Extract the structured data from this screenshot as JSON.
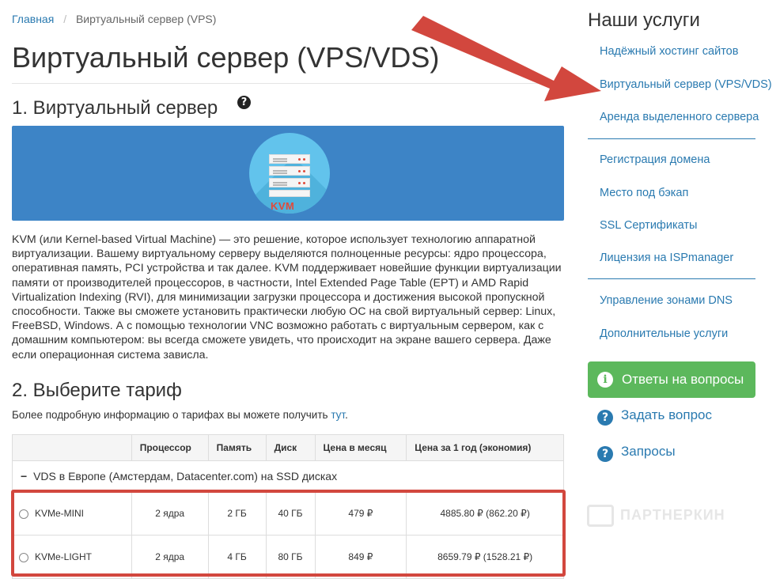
{
  "breadcrumb": {
    "home": "Главная",
    "current": "Виртуальный сервер (VPS)"
  },
  "page_title": "Виртуальный сервер (VPS/VDS)",
  "section1": {
    "title": "1. Виртуальный сервер",
    "help_glyph": "?"
  },
  "banner": {
    "label": "KVM",
    "icon": "server-icon",
    "color": "#3d84c6"
  },
  "description": "KVM (или Kernel-based Virtual Machine) — это решение, которое использует технологию аппаратной виртуализации. Вашему виртуальному серверу выделяются полноценные ресурсы: ядро процессора, оперативная память, PCI устройства и так далее. KVM поддерживает новейшие функции виртуализации памяти от производителей процессоров, в частности, Intel Extended Page Table (EPT) и AMD Rapid Virtualization Indexing (RVI), для минимизации загрузки процессора и достижения высокой пропускной способности. Также вы сможете установить практически любую ОС на свой виртуальный сервер: Linux, FreeBSD, Windows. А с помощью технологии VNC возможно работать с виртуальным сервером, как с домашним компьютером: вы всегда сможете увидеть, что происходит на экране вашего сервера. Даже если операционная система зависла.",
  "section2": {
    "title": "2. Выберите тариф",
    "note": "Более подробную информацию о тарифах вы можете получить",
    "note_link": "тут",
    "note_end": "."
  },
  "table": {
    "headers": [
      "",
      "Процессор",
      "Память",
      "Диск",
      "Цена в месяц",
      "Цена за 1 год (экономия)"
    ],
    "group": {
      "toggle": "−",
      "label": "VDS в Европе (Амстердам, Datacenter.com) на SSD дисках"
    },
    "rows": [
      {
        "name": "KVMe-MINI",
        "cpu": "2 ядра",
        "ram": "2 ГБ",
        "disk": "40 ГБ",
        "month": "479 ₽",
        "year": "4885.80 ₽ (862.20 ₽)"
      },
      {
        "name": "KVMe-LIGHT",
        "cpu": "2 ядра",
        "ram": "4 ГБ",
        "disk": "80 ГБ",
        "month": "849 ₽",
        "year": "8659.79 ₽ (1528.21 ₽)"
      }
    ]
  },
  "sidebar": {
    "title": "Наши услуги",
    "links": [
      "Надёжный хостинг сайтов",
      "Виртуальный сервер (VPS/VDS)",
      "Аренда выделенного сервера",
      "Регистрация домена",
      "Место под бэкап",
      "SSL Сертификаты",
      "Лицензия на ISPmanager",
      "Управление зонами DNS",
      "Дополнительные услуги"
    ],
    "faq_button": "Ответы на вопросы",
    "faq_icon": "i",
    "ask": "Задать вопрос",
    "requests": "Запросы",
    "action_icon": "?"
  },
  "watermark": "ПАРТНЕРКИН",
  "colors": {
    "link": "#2a7ab0",
    "accent_green": "#5cb85c",
    "highlight_red": "#d2473e"
  }
}
